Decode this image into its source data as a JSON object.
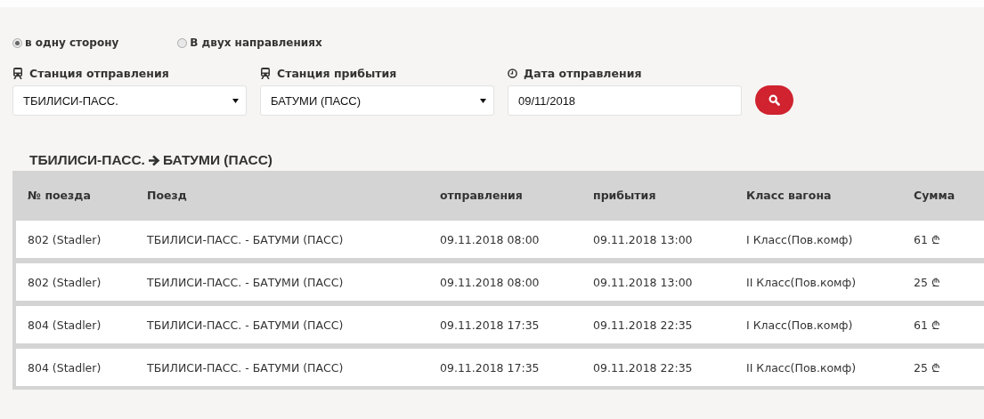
{
  "trip_type": [
    {
      "label": "в одну сторону",
      "selected": true
    },
    {
      "label": "В двух направлениях",
      "selected": false
    }
  ],
  "fields": [
    {
      "kind": "select",
      "label": "Станция отправления",
      "value": "ТБИЛИСИ-ПАСС."
    },
    {
      "kind": "select",
      "label": "Станция прибытия",
      "value": "БАТУМИ (ПАСС)"
    },
    {
      "kind": "date",
      "label": "Дата отправления",
      "value": "09/11/2018"
    }
  ],
  "route": {
    "from": "ТБИЛИСИ-ПАСС.",
    "to": "БАТУМИ (ПАСС)"
  },
  "table": {
    "columns": [
      "№ поезда",
      "Поезд",
      "отправления",
      "прибытия",
      "Класс вагона",
      "Сумма"
    ],
    "rows": [
      [
        "802 (Stadler)",
        "ТБИЛИСИ-ПАСС. - БАТУМИ (ПАСС)",
        "09.11.2018 08:00",
        "09.11.2018 13:00",
        "I Класс(Пов.комф)",
        "61 ₾"
      ],
      [
        "802 (Stadler)",
        "ТБИЛИСИ-ПАСС. - БАТУМИ (ПАСС)",
        "09.11.2018 08:00",
        "09.11.2018 13:00",
        "II Класс(Пов.комф)",
        "25 ₾"
      ],
      [
        "804 (Stadler)",
        "ТБИЛИСИ-ПАСС. - БАТУМИ (ПАСС)",
        "09.11.2018 17:35",
        "09.11.2018 22:35",
        "I Класс(Пов.комф)",
        "61 ₾"
      ],
      [
        "804 (Stadler)",
        "ТБИЛИСИ-ПАСС. - БАТУМИ (ПАСС)",
        "09.11.2018 17:35",
        "09.11.2018 22:35",
        "II Класс(Пов.комф)",
        "25 ₾"
      ]
    ]
  }
}
